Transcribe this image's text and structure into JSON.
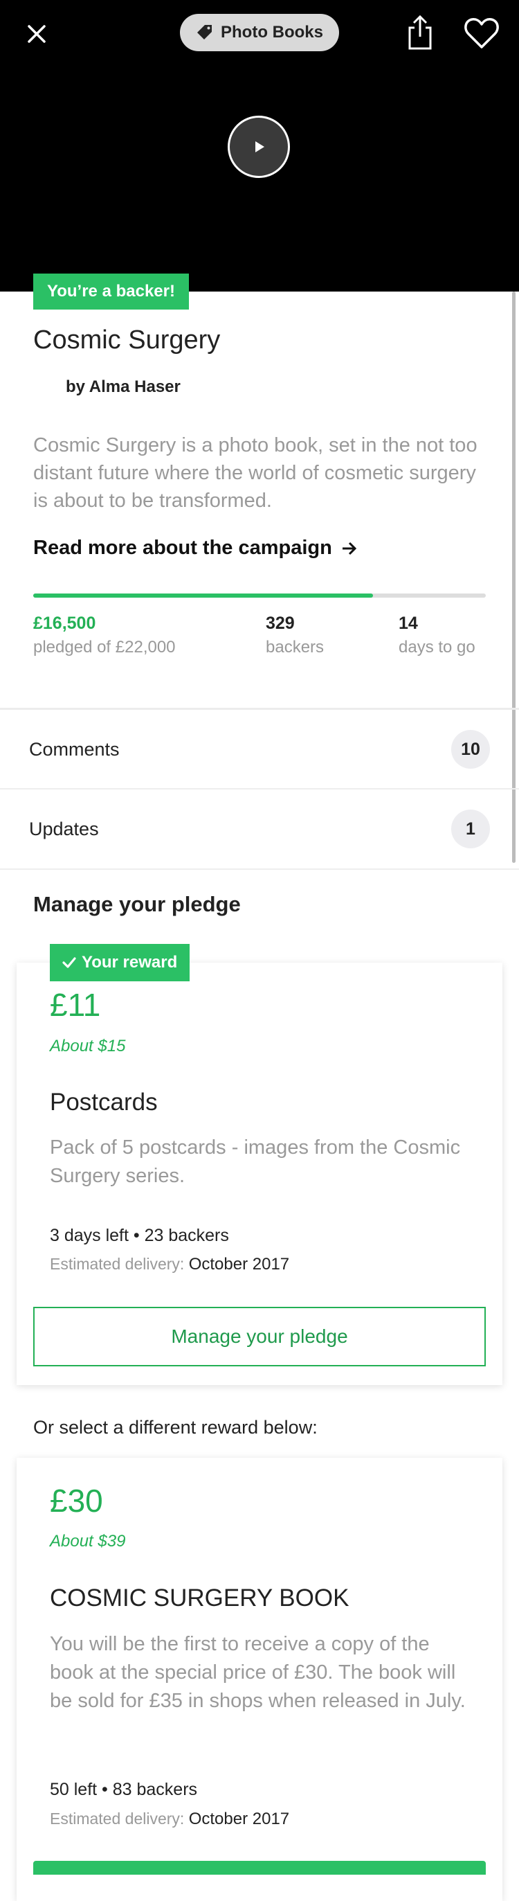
{
  "header": {
    "category": "Photo Books"
  },
  "project": {
    "backer_badge": "You’re a backer!",
    "title": "Cosmic Surgery",
    "creator": "by Alma Haser",
    "blurb": "Cosmic Surgery is a photo book, set in the not too distant future where the world of cosmetic surgery is about to be transformed.",
    "read_more": "Read more about the campaign",
    "progress_fraction": 0.75,
    "stats": {
      "pledged_value": "£16,500",
      "pledged_label": "pledged of £22,000",
      "backers_value": "329",
      "backers_label": "backers",
      "days_value": "14",
      "days_label": "days to go"
    }
  },
  "rows": {
    "comments_label": "Comments",
    "comments_count": "10",
    "updates_label": "Updates",
    "updates_count": "1"
  },
  "manage": {
    "section_title": "Manage your pledge",
    "reward_badge": "Your reward",
    "price": "£11",
    "about": "About $15",
    "title": "Postcards",
    "description": "Pack of 5 postcards - images from the Cosmic Surgery series.",
    "meta": "3 days left • 23 backers",
    "delivery_label": "Estimated delivery:",
    "delivery_value": "October 2017",
    "button_label": "Manage your pledge"
  },
  "other": {
    "prompt": "Or select a different reward below:",
    "price": "£30",
    "about": "About $39",
    "title": "COSMIC SURGERY BOOK",
    "description": "You will be the first to receive a copy of the book at the special price of £30. The book will be sold for £35 in shops when released in July.",
    "meta": "50 left • 83 backers",
    "delivery_label": "Estimated delivery:",
    "delivery_value": "October 2017"
  },
  "colors": {
    "accent": "#2bc065",
    "accent_text": "#23b055",
    "muted": "#999999"
  },
  "icons": [
    "close-icon",
    "tag-icon",
    "share-icon",
    "heart-icon",
    "play-icon",
    "arrow-right-icon",
    "checkmark-icon"
  ]
}
